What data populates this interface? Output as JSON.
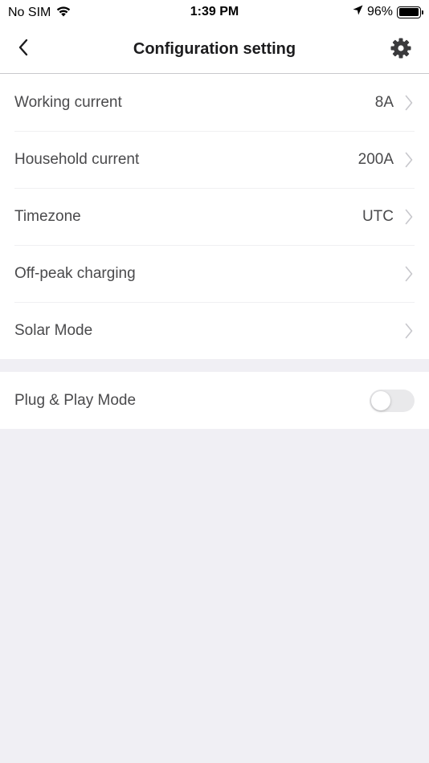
{
  "status_bar": {
    "carrier": "No SIM",
    "time": "1:39 PM",
    "battery": "96%",
    "battery_level": 0.96
  },
  "header": {
    "title": "Configuration setting",
    "back_icon": "chevron-left-icon",
    "settings_icon": "gear-icon"
  },
  "settings": [
    {
      "label": "Working current",
      "value": "8A"
    },
    {
      "label": "Household current",
      "value": "200A"
    },
    {
      "label": "Timezone",
      "value": "UTC"
    },
    {
      "label": "Off-peak charging",
      "value": ""
    },
    {
      "label": "Solar Mode",
      "value": ""
    }
  ],
  "plug_and_play": {
    "label": "Plug & Play Mode",
    "enabled": false
  },
  "colors": {
    "background": "#f0eff4",
    "card": "#ffffff",
    "text": "#4a4a4c",
    "toggle_off": "#e9e9eb"
  }
}
